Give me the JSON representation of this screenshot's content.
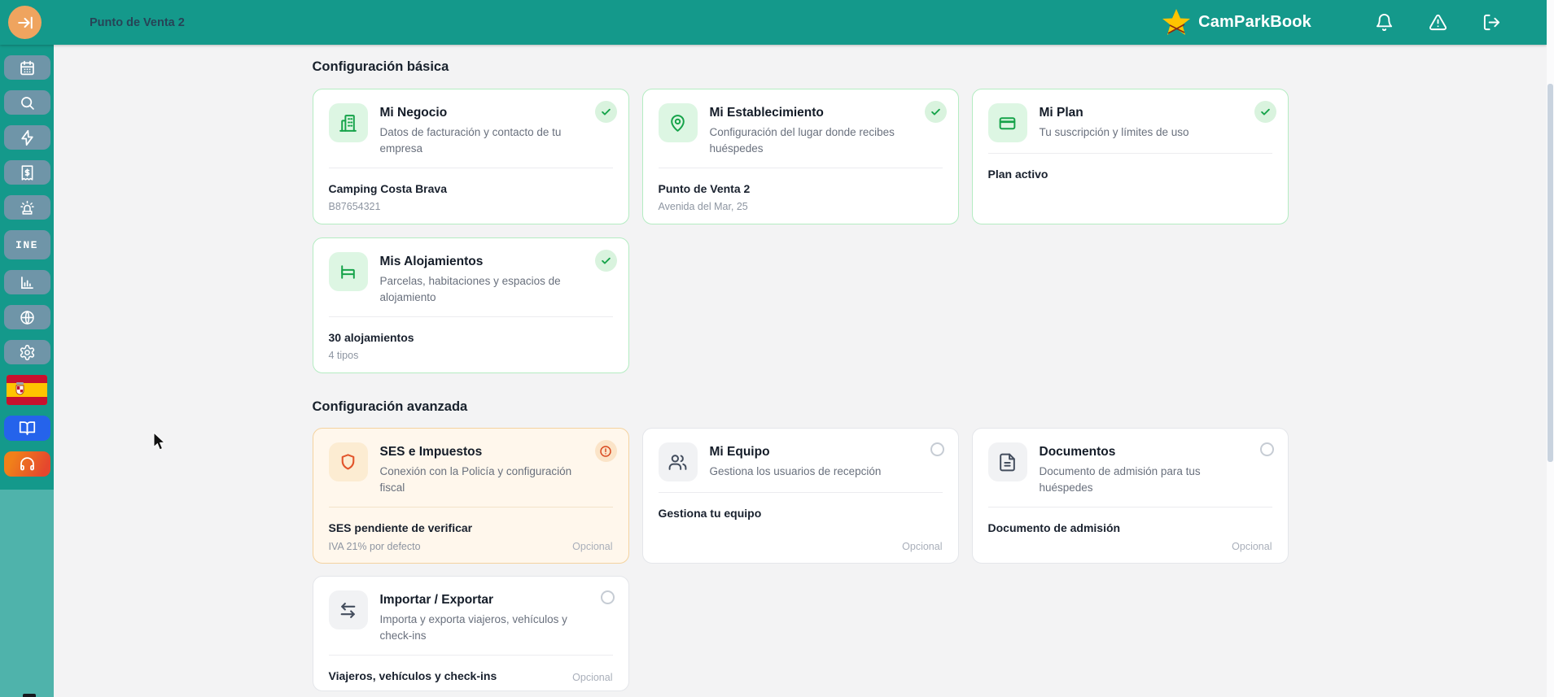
{
  "colors": {
    "header_teal": "#14998b",
    "sidebar_teal_light": "#4fb3ab",
    "sidebar_button": "#6f95a8",
    "accent_orange_button": "#efa45f",
    "success_green": "#16a34a",
    "warning_orange": "#e2552b",
    "brand_star_yellow": "#ffc400",
    "book_button_blue": "#2563eb"
  },
  "header": {
    "location": "Punto de Venta 2",
    "brand": "CamParkBook",
    "icons": [
      "arrow-right-to-line",
      "bell",
      "triangle-alert",
      "log-out"
    ]
  },
  "sidebar": {
    "ine_label": "INE",
    "icons": [
      "calendar",
      "search",
      "zap",
      "receipt-dollar",
      "siren",
      "ine-text",
      "bar-chart",
      "globe",
      "gear",
      "spain-flag",
      "book-open",
      "headphones"
    ]
  },
  "main": {
    "sections": [
      {
        "title": "Configuración básica",
        "cards": [
          {
            "title": "Mi Negocio",
            "description": "Datos de facturación y contacto de tu empresa",
            "icon": "building",
            "status": "completed",
            "footer_bold": "Camping Costa Brava",
            "footer_sub": "B87654321"
          },
          {
            "title": "Mi Establecimiento",
            "description": "Configuración del lugar donde recibes huéspedes",
            "icon": "map-pin",
            "status": "completed",
            "footer_bold": "Punto de Venta 2",
            "footer_sub": "Avenida del Mar, 25"
          },
          {
            "title": "Mi Plan",
            "description": "Tu suscripción y límites de uso",
            "icon": "credit-card",
            "status": "completed",
            "footer_bold": "Plan activo"
          },
          {
            "title": "Mis Alojamientos",
            "description": "Parcelas, habitaciones y espacios de alojamiento",
            "icon": "bed",
            "status": "completed",
            "footer_bold": "30 alojamientos",
            "footer_sub": "4 tipos"
          }
        ]
      },
      {
        "title": "Configuración avanzada",
        "cards": [
          {
            "title": "SES e Impuestos",
            "description": "Conexión con la Policía y configuración fiscal",
            "icon": "shield",
            "status": "warning",
            "footer_bold": "SES pendiente de verificar",
            "footer_sub": "IVA 21% por defecto",
            "badge": "Opcional"
          },
          {
            "title": "Mi Equipo",
            "description": "Gestiona los usuarios de recepción",
            "icon": "users",
            "status": "pending",
            "footer_bold": "Gestiona tu equipo",
            "badge": "Opcional"
          },
          {
            "title": "Documentos",
            "description": "Documento de admisión para tus huéspedes",
            "icon": "file-text",
            "status": "pending",
            "footer_bold": "Documento de admisión",
            "badge": "Opcional"
          },
          {
            "title": "Importar / Exportar",
            "description": "Importa y exporta viajeros, vehículos y check-ins",
            "icon": "arrows-left-right",
            "status": "pending",
            "footer_bold": "Viajeros, vehículos y check-ins",
            "badge": "Opcional"
          }
        ]
      }
    ]
  }
}
